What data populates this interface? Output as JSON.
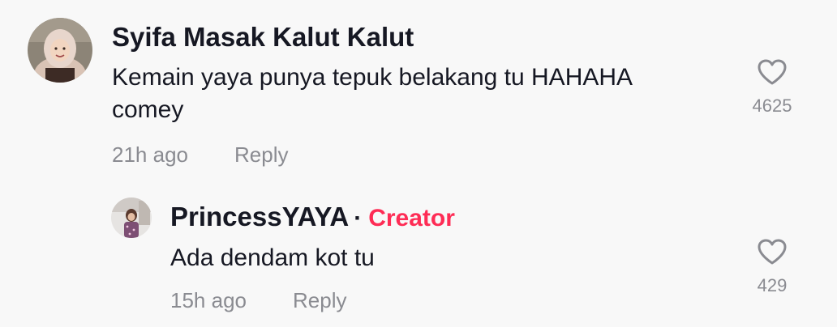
{
  "comments": [
    {
      "username": "Syifa Masak Kalut Kalut",
      "text_line1": "Kemain yaya punya tepuk belakang tu HAHAHA",
      "text_line2": "comey",
      "time": "21h ago",
      "reply_label": "Reply",
      "likes": "4625",
      "avatar_icon": "user-avatar-photo"
    }
  ],
  "reply": {
    "username": "PrincessYAYA",
    "separator": "·",
    "badge": "Creator",
    "text": "Ada dendam kot tu",
    "time": "15h ago",
    "reply_label": "Reply",
    "likes": "429",
    "avatar_icon": "creator-avatar-photo"
  },
  "colors": {
    "background": "#f8f8f8",
    "text": "#161823",
    "muted": "#8a8b91",
    "creator_accent": "#fe2c55"
  },
  "icons": {
    "like": "heart-outline-icon"
  }
}
